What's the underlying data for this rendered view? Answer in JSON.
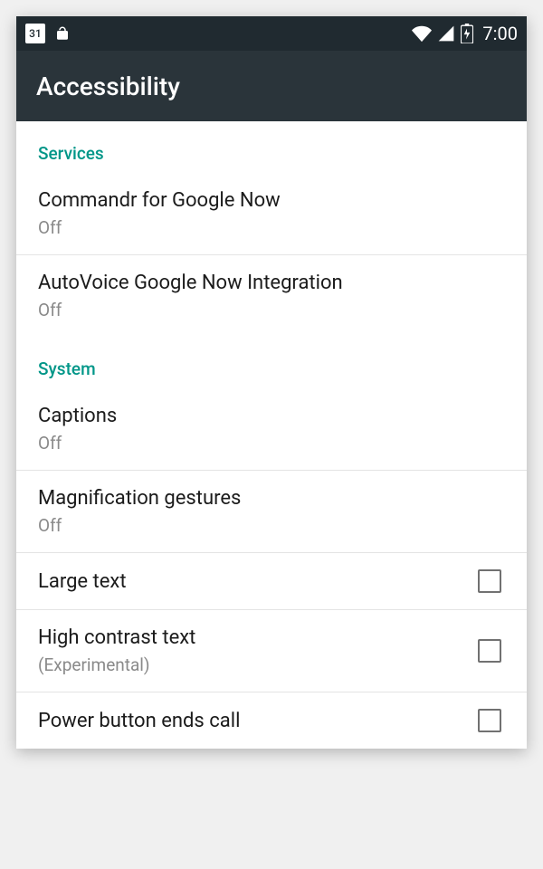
{
  "status": {
    "calendar_day": "31",
    "time": "7:00"
  },
  "appbar": {
    "title": "Accessibility"
  },
  "sections": {
    "services": {
      "header": "Services",
      "items": [
        {
          "title": "Commandr for Google Now",
          "sub": "Off"
        },
        {
          "title": "AutoVoice Google Now Integration",
          "sub": "Off"
        }
      ]
    },
    "system": {
      "header": "System",
      "items": [
        {
          "title": "Captions",
          "sub": "Off"
        },
        {
          "title": "Magnification gestures",
          "sub": "Off"
        },
        {
          "title": "Large text"
        },
        {
          "title": "High contrast text",
          "sub": "(Experimental)"
        },
        {
          "title": "Power button ends call"
        }
      ]
    }
  }
}
